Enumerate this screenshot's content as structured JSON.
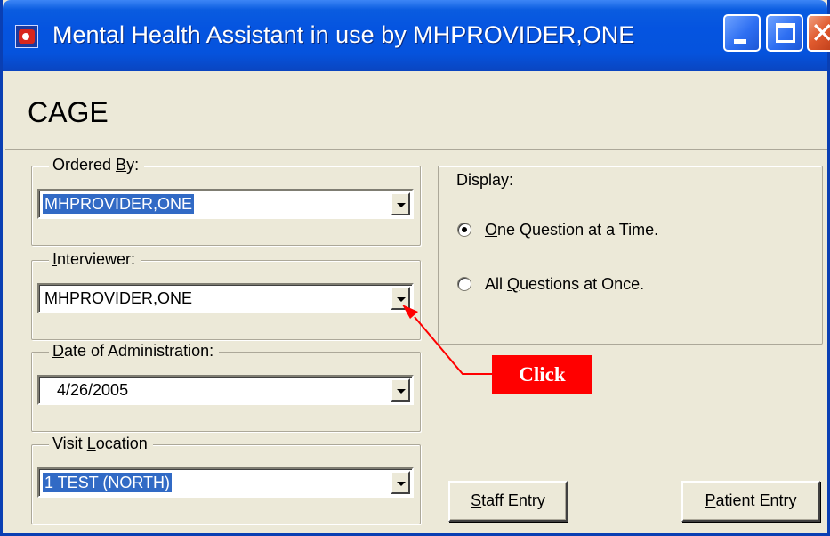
{
  "window": {
    "title": "Mental Health Assistant in use by MHPROVIDER,ONE",
    "heading": "CAGE"
  },
  "ordered_by": {
    "label_pre": "Ordered ",
    "label_accel": "B",
    "label_post": "y:",
    "value": "MHPROVIDER,ONE"
  },
  "interviewer": {
    "label_pre": "",
    "label_accel": "I",
    "label_post": "nterviewer:",
    "value": "MHPROVIDER,ONE"
  },
  "date_admin": {
    "label_pre": "",
    "label_accel": "D",
    "label_post": "ate of Administration:",
    "value": "4/26/2005"
  },
  "visit_location": {
    "label_pre": "Visit ",
    "label_accel": "L",
    "label_post": "ocation",
    "value": "1 TEST (NORTH)"
  },
  "display": {
    "label": "Display:",
    "options": [
      {
        "accel": "O",
        "rest": "ne Question at a Time.",
        "selected": true
      },
      {
        "pre": "All ",
        "accel": "Q",
        "rest": "uestions at Once.",
        "selected": false
      }
    ]
  },
  "buttons": {
    "staff_accel": "S",
    "staff_rest": "taff Entry",
    "patient_accel": "P",
    "patient_rest": "atient Entry"
  },
  "annotation": {
    "text": "Click",
    "color": "#ff0000"
  },
  "colors": {
    "titlebar": "#0554e0",
    "selection": "#316ac5",
    "dialog_bg": "#ece9d8"
  }
}
